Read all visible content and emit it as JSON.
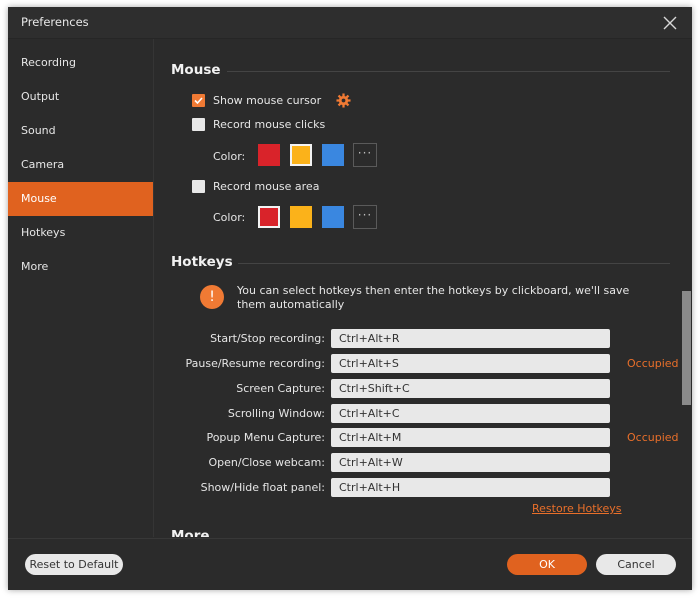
{
  "window": {
    "title": "Preferences",
    "close_icon": "close-icon"
  },
  "sidebar": {
    "items": [
      {
        "label": "Recording",
        "active": false
      },
      {
        "label": "Output",
        "active": false
      },
      {
        "label": "Sound",
        "active": false
      },
      {
        "label": "Camera",
        "active": false
      },
      {
        "label": "Mouse",
        "active": true
      },
      {
        "label": "Hotkeys",
        "active": false
      },
      {
        "label": "More",
        "active": false
      }
    ]
  },
  "mouse": {
    "title": "Mouse",
    "show_cursor": {
      "label": "Show mouse cursor",
      "checked": true,
      "settings_icon": "gear-icon"
    },
    "record_clicks": {
      "label": "Record mouse clicks",
      "checked": false,
      "color_label": "Color:",
      "colors": [
        "#d9232a",
        "#fbb21a",
        "#3a87e0"
      ],
      "selected_index": 1,
      "more_label": "···"
    },
    "record_area": {
      "label": "Record mouse area",
      "checked": false,
      "color_label": "Color:",
      "colors": [
        "#d9232a",
        "#fbb21a",
        "#3a87e0"
      ],
      "selected_index": 0,
      "more_label": "···"
    }
  },
  "hotkeys": {
    "title": "Hotkeys",
    "info_icon": "!",
    "info_text": "You can select hotkeys then enter the hotkeys by clickboard, we'll save them automatically",
    "items": [
      {
        "label": "Start/Stop recording:",
        "value": "Ctrl+Alt+R",
        "status": ""
      },
      {
        "label": "Pause/Resume recording:",
        "value": "Ctrl+Alt+S",
        "status": "Occupied"
      },
      {
        "label": "Screen Capture:",
        "value": "Ctrl+Shift+C",
        "status": ""
      },
      {
        "label": "Scrolling Window:",
        "value": "Ctrl+Alt+C",
        "status": ""
      },
      {
        "label": "Popup Menu Capture:",
        "value": "Ctrl+Alt+M",
        "status": "Occupied"
      },
      {
        "label": "Open/Close webcam:",
        "value": "Ctrl+Alt+W",
        "status": ""
      },
      {
        "label": "Show/Hide float panel:",
        "value": "Ctrl+Alt+H",
        "status": ""
      }
    ],
    "restore_label": "Restore Hotkeys"
  },
  "more": {
    "title": "More"
  },
  "footer": {
    "reset_label": "Reset to Default",
    "ok_label": "OK",
    "cancel_label": "Cancel"
  },
  "colors": {
    "accent": "#e0621f",
    "occupied": "#e96f2a",
    "background": "#2b2b2b"
  }
}
